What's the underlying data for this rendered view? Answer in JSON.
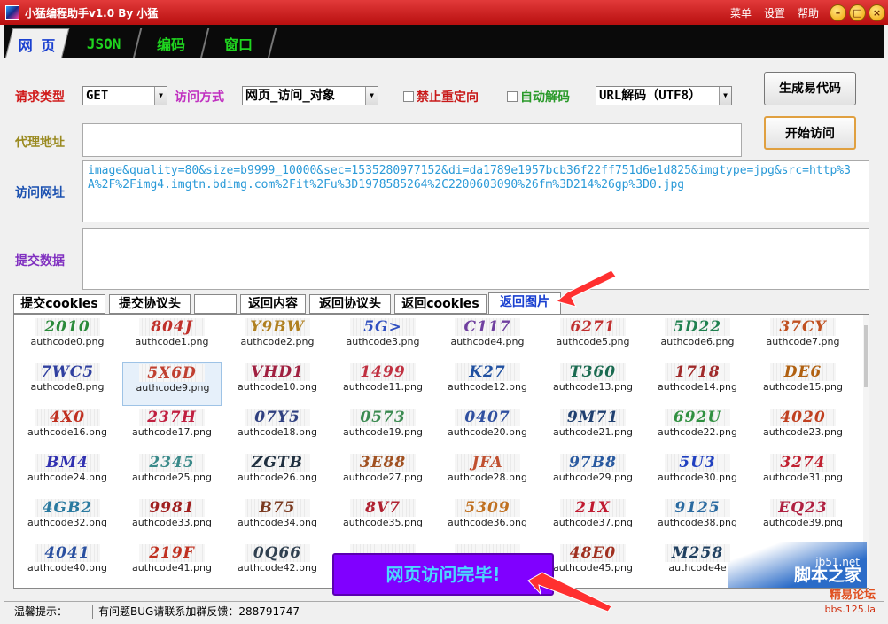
{
  "window": {
    "title": "小猛编程助手v1.0   By 小猛",
    "menu": [
      "菜单",
      "设置",
      "帮助"
    ]
  },
  "colors": {
    "titlebar": "#c81818",
    "tab_active_text": "#1a40d0",
    "tab_text": "#1fd41f",
    "toast_bg": "#8000ff",
    "toast_text": "#4ad8ff",
    "url_text": "#2a9ad8"
  },
  "main_tabs": [
    {
      "label": "网 页"
    },
    {
      "label": "JSON"
    },
    {
      "label": "编码"
    },
    {
      "label": "窗口"
    }
  ],
  "form": {
    "request_type_label": "请求类型",
    "request_type_value": "GET",
    "access_method_label": "访问方式",
    "access_method_value": "网页_访问_对象",
    "no_redirect_label": "禁止重定向",
    "auto_decode_label": "自动解码",
    "url_decode_value": "URL解码（UTF8）",
    "proxy_label": "代理地址",
    "proxy_value": "",
    "url_label": "访问网址",
    "url_value": "image&quality=80&size=b9999_10000&sec=1535280977152&di=da1789e1957bcb36f22ff751d6e1d825&imgtype=jpg&src=http%3A%2F%2Fimg4.imgtn.bdimg.com%2Fit%2Fu%3D1978585264%2C2200603090%26fm%3D214%26gp%3D0.jpg",
    "post_label": "提交数据",
    "post_value": ""
  },
  "buttons": {
    "generate": "生成易代码",
    "start": "开始访问"
  },
  "sub_tabs": [
    "提交cookies",
    "提交协议头",
    "",
    "返回内容",
    "返回协议头",
    "返回cookies",
    "返回图片"
  ],
  "images": [
    {
      "code": "2010",
      "name": "authcode0.png",
      "color": "#2a8a3a"
    },
    {
      "code": "804J",
      "name": "authcode1.png",
      "color": "#c0302a"
    },
    {
      "code": "Y9BW",
      "name": "authcode2.png",
      "color": "#b08020"
    },
    {
      "code": "5G>",
      "name": "authcode3.png",
      "color": "#3050c0"
    },
    {
      "code": "C117",
      "name": "authcode4.png",
      "color": "#7040a0"
    },
    {
      "code": "6271",
      "name": "authcode5.png",
      "color": "#c03030"
    },
    {
      "code": "5D22",
      "name": "authcode6.png",
      "color": "#208050"
    },
    {
      "code": "37CY",
      "name": "authcode7.png",
      "color": "#c05020"
    },
    {
      "code": "7WC5",
      "name": "authcode8.png",
      "color": "#3040a0"
    },
    {
      "code": "5X6D",
      "name": "authcode9.png",
      "color": "#c04030"
    },
    {
      "code": "VHD1",
      "name": "authcode10.png",
      "color": "#a02040"
    },
    {
      "code": "1499",
      "name": "authcode11.png",
      "color": "#c03040"
    },
    {
      "code": "K27",
      "name": "authcode12.png",
      "color": "#2050a0"
    },
    {
      "code": "T360",
      "name": "authcode13.png",
      "color": "#1a6a50"
    },
    {
      "code": "1718",
      "name": "authcode14.png",
      "color": "#a02a2a"
    },
    {
      "code": "DE6",
      "name": "authcode15.png",
      "color": "#b06010"
    },
    {
      "code": "4X0",
      "name": "authcode16.png",
      "color": "#c03020"
    },
    {
      "code": "237H",
      "name": "authcode17.png",
      "color": "#c02040"
    },
    {
      "code": "07Y5",
      "name": "authcode18.png",
      "color": "#304080"
    },
    {
      "code": "0573",
      "name": "authcode19.png",
      "color": "#3a8a50"
    },
    {
      "code": "0407",
      "name": "authcode20.png",
      "color": "#3050a0"
    },
    {
      "code": "9M71",
      "name": "authcode21.png",
      "color": "#204070"
    },
    {
      "code": "692U",
      "name": "authcode22.png",
      "color": "#309040"
    },
    {
      "code": "4020",
      "name": "authcode23.png",
      "color": "#c04020"
    },
    {
      "code": "BM4",
      "name": "authcode24.png",
      "color": "#3030b0"
    },
    {
      "code": "2345",
      "name": "authcode25.png",
      "color": "#3a8a8a"
    },
    {
      "code": "ZGTB",
      "name": "authcode26.png",
      "color": "#203040"
    },
    {
      "code": "3E88",
      "name": "authcode27.png",
      "color": "#a05020"
    },
    {
      "code": "JFA",
      "name": "authcode28.png",
      "color": "#c05030"
    },
    {
      "code": "97B8",
      "name": "authcode29.png",
      "color": "#2a5aa0"
    },
    {
      "code": "5U3",
      "name": "authcode30.png",
      "color": "#2040c0"
    },
    {
      "code": "3274",
      "name": "authcode31.png",
      "color": "#c02030"
    },
    {
      "code": "4GB2",
      "name": "authcode32.png",
      "color": "#2a7aa0"
    },
    {
      "code": "9981",
      "name": "authcode33.png",
      "color": "#a02020"
    },
    {
      "code": "B75",
      "name": "authcode34.png",
      "color": "#7a3a20"
    },
    {
      "code": "8V7",
      "name": "authcode35.png",
      "color": "#b02030"
    },
    {
      "code": "5309",
      "name": "authcode36.png",
      "color": "#c07020"
    },
    {
      "code": "21X",
      "name": "authcode37.png",
      "color": "#c01a30"
    },
    {
      "code": "9125",
      "name": "authcode38.png",
      "color": "#2a6aa0"
    },
    {
      "code": "EQ23",
      "name": "authcode39.png",
      "color": "#b02040"
    },
    {
      "code": "4041",
      "name": "authcode40.png",
      "color": "#2a50a0"
    },
    {
      "code": "219F",
      "name": "authcode41.png",
      "color": "#c03020"
    },
    {
      "code": "0Q66",
      "name": "authcode42.png",
      "color": "#304050"
    },
    {
      "code": "",
      "name": "",
      "color": "#3050a0"
    },
    {
      "code": "",
      "name": "",
      "color": "#3050a0"
    },
    {
      "code": "48E0",
      "name": "authcode45.png",
      "color": "#a03020"
    },
    {
      "code": "M258",
      "name": "authcode4e",
      "color": "#204060"
    }
  ],
  "watermark": {
    "site": "jb51.net",
    "name": "脚本之家"
  },
  "toast": "网页访问完毕!",
  "status": {
    "label": "温馨提示：",
    "message": "有问题BUG请联系加群反馈：288791747"
  },
  "forum": {
    "name": "精易论坛",
    "url": "bbs.125.la"
  }
}
